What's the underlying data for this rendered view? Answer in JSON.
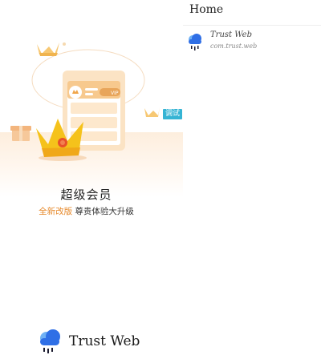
{
  "splash": {
    "debug_badge": "调试",
    "title": "超级会员",
    "subtitle_highlight": "全新改版",
    "subtitle_rest": " 尊贵体验大升级",
    "card_badge": "VIP",
    "brand_name": "Trust Web",
    "brand_icon": "cloud-rain-icon"
  },
  "panel": {
    "title": "Home",
    "apps": [
      {
        "name": "Trust Web",
        "package": "com.trust.web",
        "icon": "cloud-rain-icon"
      }
    ]
  },
  "colors": {
    "accent_orange": "#e6892b",
    "badge_cyan": "#35b4d4",
    "crown_gold": "#f5c21b",
    "brand_blue": "#2f6fe6"
  }
}
